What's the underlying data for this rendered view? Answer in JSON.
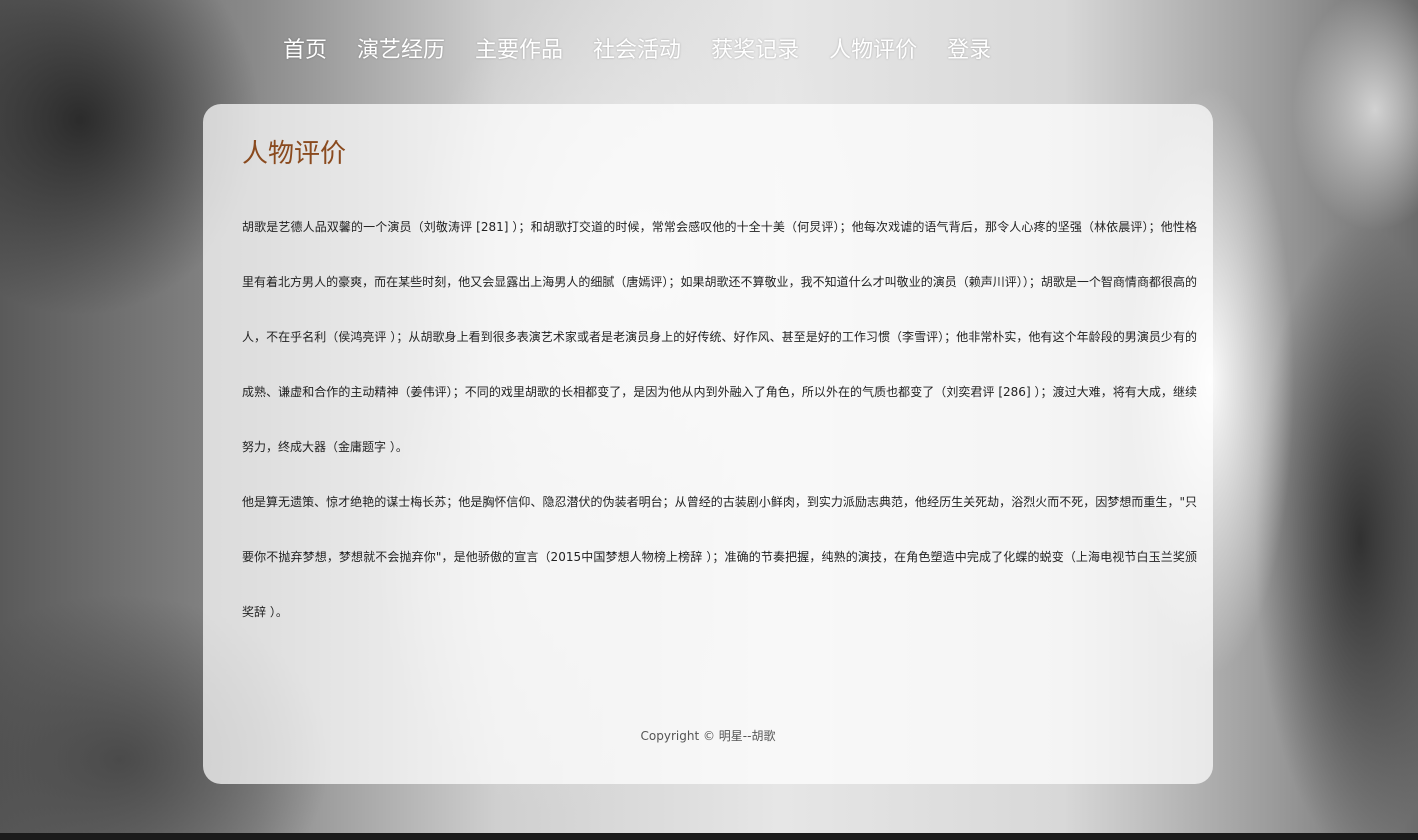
{
  "nav": {
    "items": [
      {
        "label": "首页"
      },
      {
        "label": "演艺经历"
      },
      {
        "label": "主要作品"
      },
      {
        "label": "社会活动"
      },
      {
        "label": "获奖记录"
      },
      {
        "label": "人物评价"
      },
      {
        "label": "登录"
      }
    ]
  },
  "main": {
    "title": "人物评价",
    "paragraphs": [
      "胡歌是艺德人品双馨的一个演员（刘敬涛评 [281] ）；和胡歌打交道的时候，常常会感叹他的十全十美（何炅评）；他每次戏谑的语气背后，那令人心疼的坚强（林依晨评）；他性格里有着北方男人的豪爽，而在某些时刻，他又会显露出上海男人的细腻（唐嫣评）；如果胡歌还不算敬业，我不知道什么才叫敬业的演员（赖声川评））；胡歌是一个智商情商都很高的人，不在乎名利（侯鸿亮评 ）；从胡歌身上看到很多表演艺术家或者是老演员身上的好传统、好作风、甚至是好的工作习惯（李雪评）；他非常朴实，他有这个年龄段的男演员少有的成熟、谦虚和合作的主动精神（姜伟评）；不同的戏里胡歌的长相都变了，是因为他从内到外融入了角色，所以外在的气质也都变了（刘奕君评 [286] ）；渡过大难，将有大成，继续努力，终成大器（金庸题字 ）。",
      "他是算无遗策、惊才绝艳的谋士梅长苏；他是胸怀信仰、隐忍潜伏的伪装者明台；从曾经的古装剧小鲜肉，到实力派励志典范，他经历生关死劫，浴烈火而不死，因梦想而重生，\"只要你不抛弃梦想，梦想就不会抛弃你\"，是他骄傲的宣言（2015中国梦想人物榜上榜辞 ）；准确的节奏把握，纯熟的演技，在角色塑造中完成了化蝶的蜕变（上海电视节白玉兰奖颁奖辞 ）。"
    ],
    "footer": "Copyright © 明星--胡歌"
  },
  "colors": {
    "title": "#8a4a1e",
    "nav_text": "#ffffff",
    "card_bg": "rgba(255,255,255,0.72)"
  }
}
